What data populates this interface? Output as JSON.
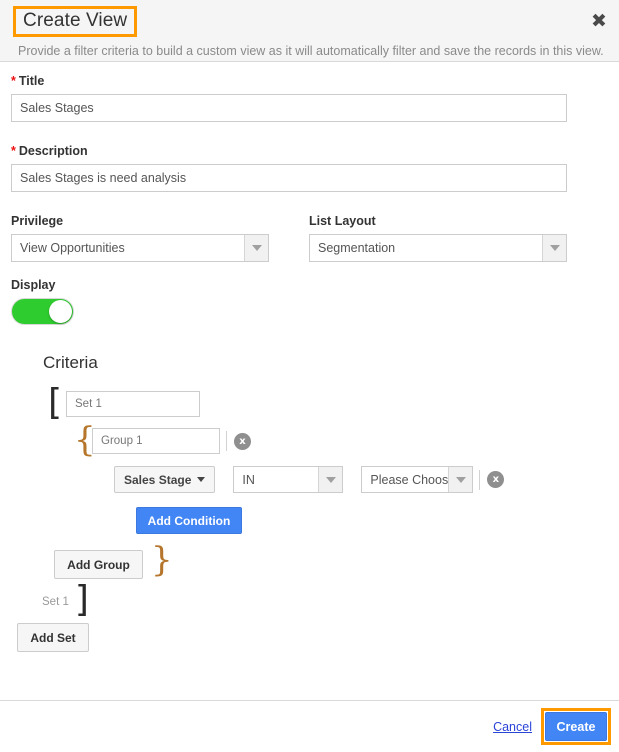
{
  "header": {
    "title": "Create View",
    "subtitle": "Provide a filter criteria to build a custom view as it will automatically filter and save the records in this view.",
    "close_icon": "close-icon",
    "title_highlight_color": "#ff9900"
  },
  "form": {
    "title_field": {
      "label": "Title",
      "required_marker": "*",
      "value": "Sales Stages"
    },
    "description_field": {
      "label": "Description",
      "required_marker": "*",
      "value": "Sales Stages is need analysis"
    },
    "privilege": {
      "label": "Privilege",
      "value": "View Opportunities"
    },
    "list_layout": {
      "label": "List Layout",
      "value": "Segmentation"
    },
    "display": {
      "label": "Display",
      "state": "on",
      "on_color": "#2fcc2f"
    }
  },
  "criteria": {
    "heading": "Criteria",
    "set": {
      "open_bracket": "[",
      "name": "Set 1",
      "close_bracket": "]",
      "close_label": "Set 1"
    },
    "group": {
      "open_brace": "{",
      "name": "Group 1",
      "close_brace": "}",
      "remove_icon": "x"
    },
    "condition": {
      "field": "Sales Stage",
      "operator": "IN",
      "value": "Please Choose",
      "remove_icon": "x"
    },
    "buttons": {
      "add_condition": "Add Condition",
      "add_group": "Add Group",
      "add_set": "Add Set",
      "primary_color": "#4285f4"
    }
  },
  "footer": {
    "cancel": "Cancel",
    "create": "Create",
    "create_highlight_color": "#ff9900"
  }
}
